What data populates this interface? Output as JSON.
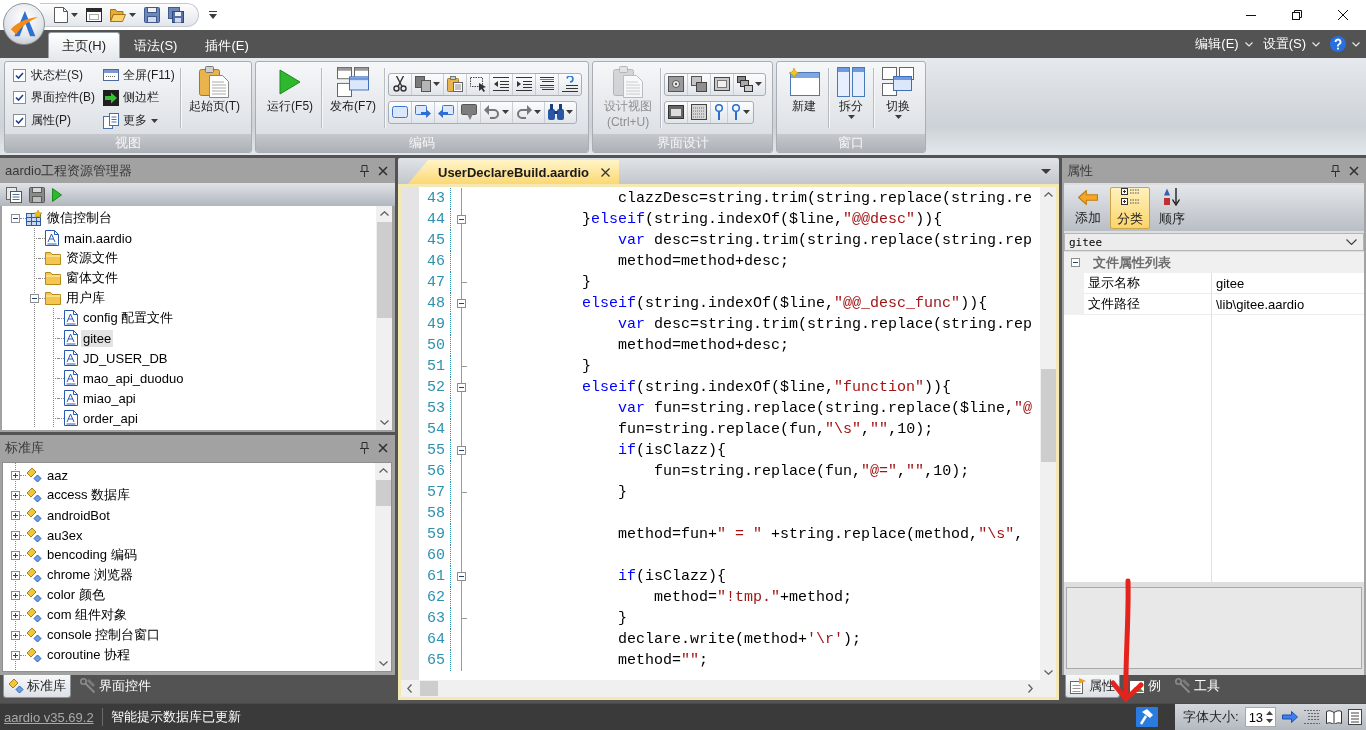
{
  "ribbon": {
    "tabs": [
      {
        "label": "主页(H)",
        "selected": true
      },
      {
        "label": "语法(S)",
        "selected": false
      },
      {
        "label": "插件(E)",
        "selected": false
      }
    ],
    "menus": [
      {
        "label": "编辑(E)"
      },
      {
        "label": "设置(S)"
      }
    ],
    "groups": [
      {
        "title": "视图",
        "sections": [
          {
            "kind": "checks",
            "items": [
              {
                "label": "状态栏(S)",
                "checked": true
              },
              {
                "label": "界面控件(B)",
                "checked": true
              },
              {
                "label": "属性(P)",
                "checked": true
              }
            ]
          },
          {
            "kind": "small",
            "items": [
              {
                "label": "全屏(F11)",
                "menu": false
              },
              {
                "label": "侧边栏",
                "menu": false
              },
              {
                "label": "更多",
                "menu": true
              }
            ]
          },
          {
            "kind": "large",
            "items": [
              {
                "lines": [
                  "起始页(T)"
                ],
                "menu": false,
                "disabled": false
              }
            ]
          }
        ]
      },
      {
        "title": "编码",
        "sections": [
          {
            "kind": "large",
            "items": [
              {
                "lines": [
                  "运行(F5)"
                ],
                "menu": false,
                "disabled": false
              },
              {
                "lines": [
                  "发布(F7)"
                ],
                "menu": false,
                "disabled": false
              }
            ]
          },
          {
            "kind": "toolbar"
          }
        ]
      },
      {
        "title": "界面设计",
        "sections": [
          {
            "kind": "large",
            "items": [
              {
                "lines": [
                  "设计视图",
                  "(Ctrl+U)"
                ],
                "menu": false,
                "disabled": true
              }
            ]
          },
          {
            "kind": "toolbar"
          }
        ]
      },
      {
        "title": "窗口",
        "sections": [
          {
            "kind": "large",
            "items": [
              {
                "lines": [
                  "新建"
                ],
                "menu": false,
                "disabled": false
              },
              {
                "lines": [
                  "拆分"
                ],
                "menu": true,
                "disabled": false
              },
              {
                "lines": [
                  "切换"
                ],
                "menu": true,
                "disabled": false
              }
            ]
          }
        ]
      }
    ]
  },
  "explorer": {
    "title": "aardio工程资源管理器",
    "tree": [
      {
        "label": "微信控制台",
        "kind": "project",
        "selected": false,
        "expanded": true,
        "children": [
          {
            "label": "main.aardio",
            "kind": "file",
            "selected": false
          },
          {
            "label": "资源文件",
            "kind": "folder",
            "selected": false
          },
          {
            "label": "窗体文件",
            "kind": "folder",
            "selected": false
          },
          {
            "label": "用户库",
            "kind": "folder",
            "selected": false,
            "expanded": true,
            "children": [
              {
                "label": "config 配置文件",
                "kind": "file",
                "selected": false
              },
              {
                "label": "gitee",
                "kind": "file",
                "selected": true
              },
              {
                "label": "JD_USER_DB",
                "kind": "file",
                "selected": false
              },
              {
                "label": "mao_api_duoduo",
                "kind": "file",
                "selected": false
              },
              {
                "label": "miao_api",
                "kind": "file",
                "selected": false
              },
              {
                "label": "order_api",
                "kind": "file",
                "selected": false
              }
            ]
          }
        ]
      }
    ]
  },
  "library": {
    "title": "标准库",
    "items": [
      {
        "label": "aaz",
        "expanded": false
      },
      {
        "label": "access 数据库",
        "expanded": false
      },
      {
        "label": "androidBot",
        "expanded": false
      },
      {
        "label": "au3ex",
        "expanded": false
      },
      {
        "label": "bencoding 编码",
        "expanded": false
      },
      {
        "label": "chrome 浏览器",
        "expanded": false
      },
      {
        "label": "color 颜色",
        "expanded": false
      },
      {
        "label": "com 组件对象",
        "expanded": false
      },
      {
        "label": "console 控制台窗口",
        "expanded": false
      },
      {
        "label": "coroutine 协程",
        "expanded": false
      }
    ]
  },
  "left_tabs": [
    {
      "label": "标准库",
      "selected": true
    },
    {
      "label": "界面控件",
      "selected": false
    }
  ],
  "editor": {
    "tabs": [
      {
        "label": "UserDeclareBuild.aardio",
        "selected": true
      }
    ],
    "lines": [
      {
        "number": "43",
        "fold_start": false,
        "fold_end": false,
        "tokens": [
          {
            "kind": "plain",
            "text": "                clazzDesc=string.trim(string.replace(string.re"
          }
        ]
      },
      {
        "number": "44",
        "fold_start": true,
        "fold_end": false,
        "tokens": [
          {
            "kind": "plain",
            "text": "            }"
          },
          {
            "kind": "keyword",
            "text": "elseif"
          },
          {
            "kind": "plain",
            "text": "(string.indexOf($line,"
          },
          {
            "kind": "string",
            "text": "\"@@desc\""
          },
          {
            "kind": "plain",
            "text": ")){"
          }
        ]
      },
      {
        "number": "45",
        "fold_start": false,
        "fold_end": false,
        "tokens": [
          {
            "kind": "keyword",
            "text": "                var"
          },
          {
            "kind": "plain",
            "text": " desc=string.trim(string.replace(string.rep"
          }
        ]
      },
      {
        "number": "46",
        "fold_start": false,
        "fold_end": false,
        "tokens": [
          {
            "kind": "plain",
            "text": "                method=method+desc;"
          }
        ]
      },
      {
        "number": "47",
        "fold_start": false,
        "fold_end": true,
        "tokens": [
          {
            "kind": "plain",
            "text": "            }"
          }
        ]
      },
      {
        "number": "48",
        "fold_start": true,
        "fold_end": false,
        "tokens": [
          {
            "kind": "keyword",
            "text": "            elseif"
          },
          {
            "kind": "plain",
            "text": "(string.indexOf($line,"
          },
          {
            "kind": "string",
            "text": "\"@@_desc_func\""
          },
          {
            "kind": "plain",
            "text": ")){"
          }
        ]
      },
      {
        "number": "49",
        "fold_start": false,
        "fold_end": false,
        "tokens": [
          {
            "kind": "keyword",
            "text": "                var"
          },
          {
            "kind": "plain",
            "text": " desc=string.trim(string.replace(string.rep"
          }
        ]
      },
      {
        "number": "50",
        "fold_start": false,
        "fold_end": false,
        "tokens": [
          {
            "kind": "plain",
            "text": "                method=method+desc;"
          }
        ]
      },
      {
        "number": "51",
        "fold_start": false,
        "fold_end": true,
        "tokens": [
          {
            "kind": "plain",
            "text": "            }"
          }
        ]
      },
      {
        "number": "52",
        "fold_start": true,
        "fold_end": false,
        "tokens": [
          {
            "kind": "keyword",
            "text": "            elseif"
          },
          {
            "kind": "plain",
            "text": "(string.indexOf($line,"
          },
          {
            "kind": "string",
            "text": "\"function\""
          },
          {
            "kind": "plain",
            "text": ")){"
          }
        ]
      },
      {
        "number": "53",
        "fold_start": false,
        "fold_end": false,
        "tokens": [
          {
            "kind": "keyword",
            "text": "                var"
          },
          {
            "kind": "plain",
            "text": " fun=string.replace(string.replace($line,"
          },
          {
            "kind": "string",
            "text": "\"@"
          }
        ]
      },
      {
        "number": "54",
        "fold_start": false,
        "fold_end": false,
        "tokens": [
          {
            "kind": "plain",
            "text": "                fun=string.replace(fun,"
          },
          {
            "kind": "string",
            "text": "\"\\s\""
          },
          {
            "kind": "plain",
            "text": ","
          },
          {
            "kind": "string",
            "text": "\"\""
          },
          {
            "kind": "plain",
            "text": ",10);"
          }
        ]
      },
      {
        "number": "55",
        "fold_start": true,
        "fold_end": false,
        "tokens": [
          {
            "kind": "keyword",
            "text": "                if"
          },
          {
            "kind": "plain",
            "text": "(isClazz){"
          }
        ]
      },
      {
        "number": "56",
        "fold_start": false,
        "fold_end": false,
        "tokens": [
          {
            "kind": "plain",
            "text": "                    fun=string.replace(fun,"
          },
          {
            "kind": "string",
            "text": "\"@=\""
          },
          {
            "kind": "plain",
            "text": ","
          },
          {
            "kind": "string",
            "text": "\"\""
          },
          {
            "kind": "plain",
            "text": ",10);"
          }
        ]
      },
      {
        "number": "57",
        "fold_start": false,
        "fold_end": true,
        "tokens": [
          {
            "kind": "plain",
            "text": "                }"
          }
        ]
      },
      {
        "number": "58",
        "fold_start": false,
        "fold_end": false
      },
      {
        "number": "59",
        "fold_start": false,
        "fold_end": false,
        "tokens": [
          {
            "kind": "plain",
            "text": "                method=fun+"
          },
          {
            "kind": "string",
            "text": "\" = \""
          },
          {
            "kind": "plain",
            "text": " +string.replace(method,"
          },
          {
            "kind": "string",
            "text": "\"\\s\""
          },
          {
            "kind": "plain",
            "text": ","
          }
        ]
      },
      {
        "number": "60",
        "fold_start": false,
        "fold_end": false
      },
      {
        "number": "61",
        "fold_start": true,
        "fold_end": false,
        "tokens": [
          {
            "kind": "keyword",
            "text": "                if"
          },
          {
            "kind": "plain",
            "text": "(isClazz){"
          }
        ]
      },
      {
        "number": "62",
        "fold_start": false,
        "fold_end": false,
        "tokens": [
          {
            "kind": "plain",
            "text": "                    method="
          },
          {
            "kind": "string",
            "text": "\"!tmp.\""
          },
          {
            "kind": "plain",
            "text": "+method;"
          }
        ]
      },
      {
        "number": "63",
        "fold_start": false,
        "fold_end": true,
        "tokens": [
          {
            "kind": "plain",
            "text": "                }"
          }
        ]
      },
      {
        "number": "64",
        "fold_start": false,
        "fold_end": false,
        "tokens": [
          {
            "kind": "plain",
            "text": "                declare.write(method+"
          },
          {
            "kind": "string",
            "text": "'\\r'"
          },
          {
            "kind": "plain",
            "text": ");"
          }
        ]
      },
      {
        "number": "65",
        "fold_start": false,
        "fold_end": false,
        "tokens": [
          {
            "kind": "plain",
            "text": "                method="
          },
          {
            "kind": "string",
            "text": "\"\""
          },
          {
            "kind": "plain",
            "text": ";"
          }
        ]
      }
    ]
  },
  "properties": {
    "title": "属性",
    "toolbar": [
      {
        "label": "添加",
        "selected": false
      },
      {
        "label": "分类",
        "selected": true
      },
      {
        "label": "顺序",
        "selected": false
      }
    ],
    "object": "gitee",
    "category": {
      "title": "文件属性列表",
      "expanded": true,
      "rows": [
        {
          "name": "显示名称",
          "value": "gitee"
        },
        {
          "name": "文件路径",
          "value": "\\lib\\gitee.aardio"
        }
      ]
    }
  },
  "right_tabs": [
    {
      "label": "属性",
      "selected": true
    },
    {
      "label": "例",
      "selected": false
    },
    {
      "label": "工具",
      "selected": false
    }
  ],
  "status_bar": {
    "version": "aardio v35.69.2",
    "message": "智能提示数据库已更新",
    "font_size_label": "字体大小:",
    "font_size": "13"
  }
}
